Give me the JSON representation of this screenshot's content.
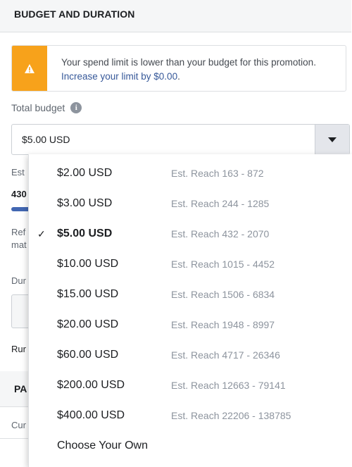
{
  "header": {
    "title": "BUDGET AND DURATION"
  },
  "alert": {
    "icon": "warning-icon",
    "color": "#f7a21b",
    "message": "Your spend limit is lower than your budget for this promotion.",
    "link_text": "Increase your limit by $0.00",
    "link_suffix": "."
  },
  "budget": {
    "label": "Total budget",
    "info_icon": "i",
    "selected_value": "$5.00 USD"
  },
  "background_fragments": {
    "est": "Est",
    "num": "430",
    "ref": "Ref",
    "mat": "mat",
    "dur": "Dur",
    "run": "Rur",
    "pa": "PA",
    "cur": "Cur"
  },
  "dropdown": {
    "items": [
      {
        "price": "$2.00 USD",
        "reach": "Est. Reach 163 - 872",
        "selected": false
      },
      {
        "price": "$3.00 USD",
        "reach": "Est. Reach 244 - 1285",
        "selected": false
      },
      {
        "price": "$5.00 USD",
        "reach": "Est. Reach 432 - 2070",
        "selected": true,
        "check": "✓"
      },
      {
        "price": "$10.00 USD",
        "reach": "Est. Reach 1015 - 4452",
        "selected": false
      },
      {
        "price": "$15.00 USD",
        "reach": "Est. Reach 1506 - 6834",
        "selected": false
      },
      {
        "price": "$20.00 USD",
        "reach": "Est. Reach 1948 - 8997",
        "selected": false
      },
      {
        "price": "$60.00 USD",
        "reach": "Est. Reach 4717 - 26346",
        "selected": false
      },
      {
        "price": "$200.00 USD",
        "reach": "Est. Reach 12663 - 79141",
        "selected": false
      },
      {
        "price": "$400.00 USD",
        "reach": "Est. Reach 22206 - 138785",
        "selected": false
      }
    ],
    "custom_label": "Choose Your Own"
  }
}
